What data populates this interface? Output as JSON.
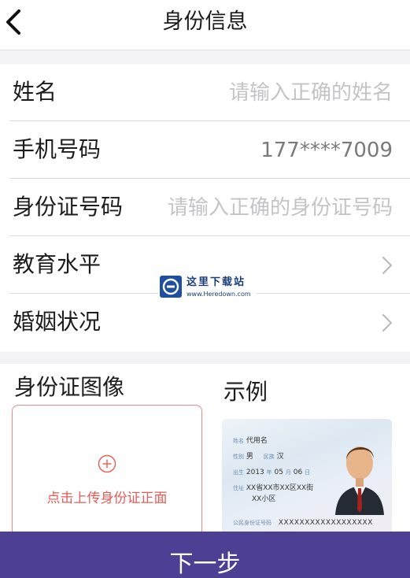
{
  "header": {
    "title": "身份信息",
    "back_icon": "chevron-left-icon"
  },
  "form": {
    "rows": [
      {
        "label": "姓名",
        "placeholder": "请输入正确的姓名"
      },
      {
        "label": "手机号码",
        "value": "177****7009"
      },
      {
        "label": "身份证号码",
        "placeholder": "请输入正确的身份证号码"
      },
      {
        "label": "教育水平",
        "icon": "chevron-right-icon"
      },
      {
        "label": "婚姻状况",
        "icon": "chevron-right-icon"
      }
    ]
  },
  "upload": {
    "title": "身份证图像",
    "example_title": "示例",
    "hint": "点击上传身份证正面",
    "plus_icon": "plus-circle-icon",
    "sample": {
      "name_key": "姓名",
      "name": "代用名",
      "gender_key": "性别",
      "gender": "男",
      "ethnicity_key": "民族",
      "ethnicity": "汉",
      "birth_key": "出生",
      "birth_year": "2013",
      "year_unit": "年",
      "birth_month": "05",
      "month_unit": "月",
      "birth_day": "06",
      "day_unit": "日",
      "address_key": "住址",
      "address_line1": "XX省XX市XX区XX街",
      "address_line2": "XX小区",
      "id_key": "公民身份证号码",
      "id_number": "XXXXXXXXXXXXXXXXXX"
    }
  },
  "watermark": {
    "name": "这里下载站",
    "url": "www.Heredown.com"
  },
  "footer": {
    "next_label": "下一步"
  },
  "colors": {
    "accent": "#4d3f94",
    "upload_border": "#e88a8a",
    "upload_hint": "#e55a55",
    "placeholder": "#c4c4c6"
  }
}
